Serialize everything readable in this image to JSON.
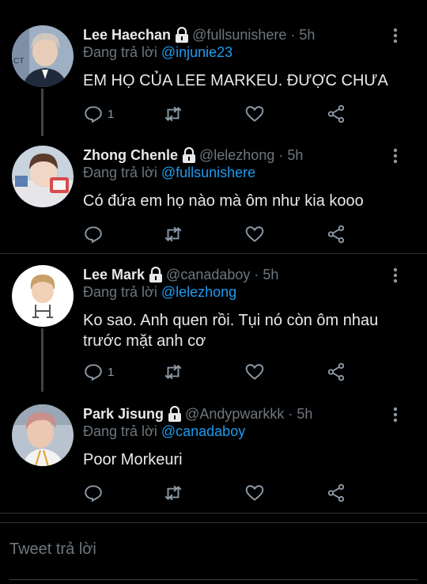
{
  "tweets": [
    {
      "name": "Lee Haechan",
      "handle": "@fullsunishere",
      "time": "5h",
      "replying_prefix": "Đang trả lời",
      "replying_to": "@injunie23",
      "text": "EM HỌ CỦA LEE MARKEU. ĐƯỢC CHƯA",
      "reply_count": "1",
      "avatar": {
        "bg": "#9fb0c4",
        "skin": "#e8cdb8",
        "hair": "#cfc7bf",
        "shirt": "#1f2a3a"
      }
    },
    {
      "name": "Zhong Chenle",
      "handle": "@lelezhong",
      "time": "5h",
      "replying_prefix": "Đang trả lời",
      "replying_to": "@fullsunishere",
      "text": "Có đứa em họ nào mà ôm như kia kooo",
      "reply_count": "",
      "avatar": {
        "bg": "#c9d3dd",
        "skin": "#f0d6c4",
        "hair": "#5a3b2c",
        "shirt": "#e6e6ea"
      }
    },
    {
      "name": "Lee Mark",
      "handle": "@canadaboy",
      "time": "5h",
      "replying_prefix": "Đang trả lời",
      "replying_to": "@lelezhong",
      "text": "Ko sao. Anh quen rồi. Tụi nó còn ôm nhau trước mặt anh cơ",
      "reply_count": "1",
      "avatar": {
        "bg": "#ffffff",
        "skin": "#f2d2b6",
        "hair": "#c9a06a",
        "shirt": "#ffffff"
      }
    },
    {
      "name": "Park Jisung",
      "handle": "@Andypwarkkk",
      "time": "5h",
      "replying_prefix": "Đang trả lời",
      "replying_to": "@canadaboy",
      "text": "Poor Morkeuri",
      "reply_count": "",
      "avatar": {
        "bg": "#b9c3cf",
        "skin": "#ecc7b1",
        "hair": "#c98f8a",
        "shirt": "#f3f3f3"
      }
    }
  ],
  "reply_box": {
    "placeholder": "Tweet trả lời"
  },
  "colors": {
    "background": "#000000",
    "mention": "#1d9bf0",
    "muted": "#6e767d",
    "icon": "#8b98a5"
  }
}
